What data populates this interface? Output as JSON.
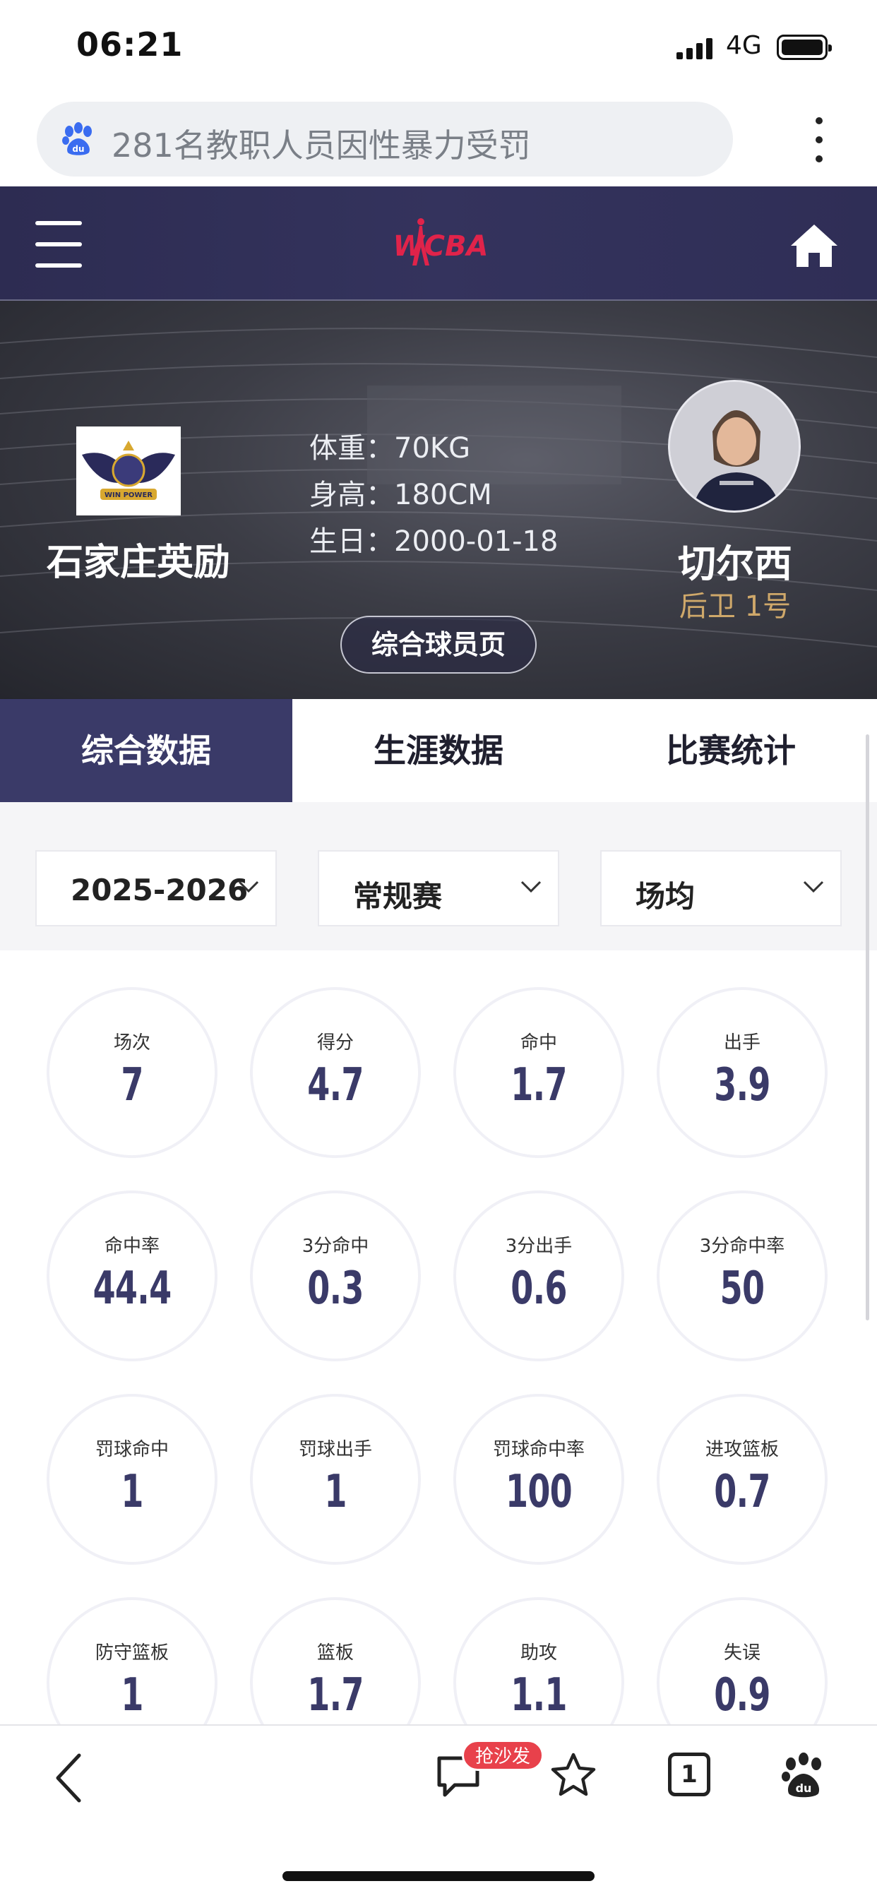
{
  "status_bar": {
    "time": "06:21",
    "network": "4G"
  },
  "search": {
    "query": "281名教职人员因性暴力受罚"
  },
  "header": {
    "logo_text": "WCBA"
  },
  "team": {
    "name": "石家庄英励",
    "logo_text": "WIN POWER"
  },
  "player": {
    "weight": "体重：70KG",
    "height": "身高：180CM",
    "birthday": "生日：2000-01-18",
    "name": "切尔西",
    "position": "后卫 1号",
    "profile_button": "综合球员页"
  },
  "tabs": [
    {
      "label": "综合数据",
      "active": true
    },
    {
      "label": "生涯数据",
      "active": false
    },
    {
      "label": "比赛统计",
      "active": false
    }
  ],
  "filters": {
    "season": "2025-2026",
    "type": "常规赛",
    "mode": "场均"
  },
  "stats": [
    {
      "label": "场次",
      "value": "7"
    },
    {
      "label": "得分",
      "value": "4.7"
    },
    {
      "label": "命中",
      "value": "1.7"
    },
    {
      "label": "出手",
      "value": "3.9"
    },
    {
      "label": "命中率",
      "value": "44.4"
    },
    {
      "label": "3分命中",
      "value": "0.3"
    },
    {
      "label": "3分出手",
      "value": "0.6"
    },
    {
      "label": "3分命中率",
      "value": "50"
    },
    {
      "label": "罚球命中",
      "value": "1"
    },
    {
      "label": "罚球出手",
      "value": "1"
    },
    {
      "label": "罚球命中率",
      "value": "100"
    },
    {
      "label": "进攻篮板",
      "value": "0.7"
    },
    {
      "label": "防守篮板",
      "value": "1"
    },
    {
      "label": "篮板",
      "value": "1.7"
    },
    {
      "label": "助攻",
      "value": "1.1"
    },
    {
      "label": "失误",
      "value": "0.9"
    }
  ],
  "bottom_bar": {
    "comment_badge": "抢沙发",
    "tab_count": "1"
  },
  "colors": {
    "nav": "#2d2c52",
    "accent": "#3a3a68",
    "gold": "#cfa86a",
    "logo_red": "#e0234a",
    "badge": "#e8414b"
  }
}
